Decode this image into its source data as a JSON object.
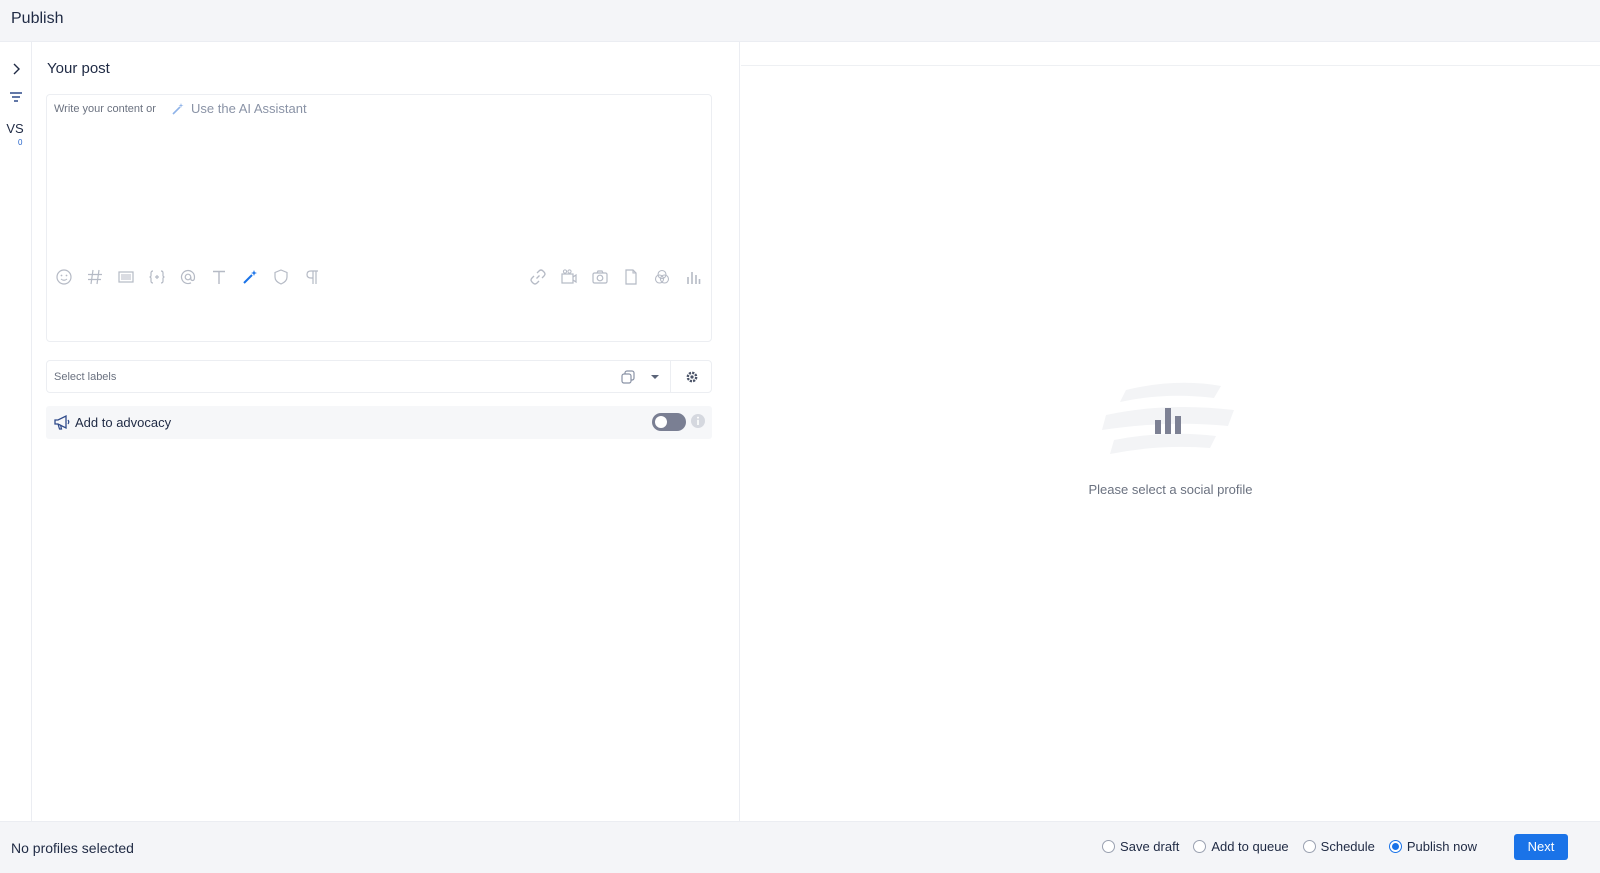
{
  "header": {
    "title": "Publish"
  },
  "rail": {
    "avatar_initials": "VS",
    "profile_count": "0",
    "icons": [
      "chevron-right-icon",
      "filter-icon"
    ]
  },
  "editor": {
    "section_title": "Your post",
    "placeholder": "Write your content or",
    "ai_assistant_label": "Use the AI Assistant",
    "toolbar_left": [
      "emoji-icon",
      "hashtag-icon",
      "snippet-icon",
      "variable-icon",
      "mention-icon",
      "text-format-icon",
      "ai-wand-icon",
      "shield-icon",
      "paragraph-icon"
    ],
    "toolbar_right": [
      "link-icon",
      "video-icon",
      "camera-icon",
      "document-icon",
      "circles-icon",
      "poll-chart-icon"
    ]
  },
  "labels": {
    "placeholder": "Select labels"
  },
  "advocacy": {
    "label": "Add to advocacy",
    "enabled": false
  },
  "preview": {
    "empty_message": "Please select a social profile"
  },
  "footer": {
    "status": "No profiles selected",
    "options": [
      {
        "label": "Save draft",
        "checked": false
      },
      {
        "label": "Add to queue",
        "checked": false
      },
      {
        "label": "Schedule",
        "checked": false
      },
      {
        "label": "Publish now",
        "checked": true
      }
    ],
    "next_label": "Next"
  },
  "colors": {
    "accent": "#1a73e8",
    "muted_text": "#6b7280",
    "bg_panel": "#f4f5f8"
  }
}
